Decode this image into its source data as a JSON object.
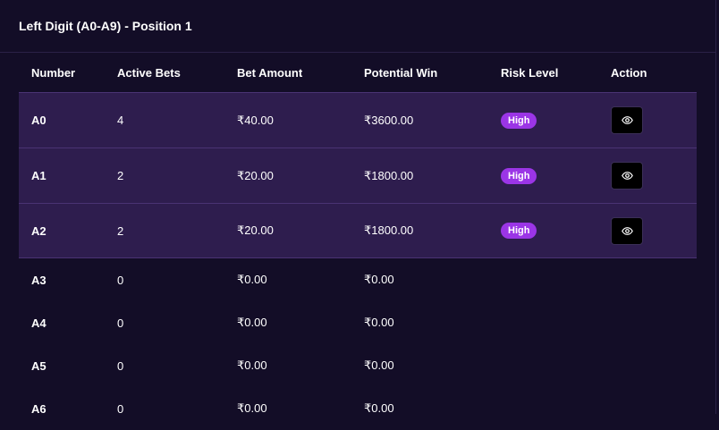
{
  "panel": {
    "title": "Left Digit (A0-A9) - Position 1"
  },
  "table": {
    "headers": {
      "number": "Number",
      "active_bets": "Active Bets",
      "bet_amount": "Bet Amount",
      "potential_win": "Potential Win",
      "risk_level": "Risk Level",
      "action": "Action"
    },
    "rows": [
      {
        "number": "A0",
        "active_bets": "4",
        "bet_amount": "₹40.00",
        "potential_win": "₹3600.00",
        "risk": "High",
        "action_icon": "eye-icon"
      },
      {
        "number": "A1",
        "active_bets": "2",
        "bet_amount": "₹20.00",
        "potential_win": "₹1800.00",
        "risk": "High",
        "action_icon": "eye-icon"
      },
      {
        "number": "A2",
        "active_bets": "2",
        "bet_amount": "₹20.00",
        "potential_win": "₹1800.00",
        "risk": "High",
        "action_icon": "eye-icon"
      },
      {
        "number": "A3",
        "active_bets": "0",
        "bet_amount": "₹0.00",
        "potential_win": "₹0.00"
      },
      {
        "number": "A4",
        "active_bets": "0",
        "bet_amount": "₹0.00",
        "potential_win": "₹0.00"
      },
      {
        "number": "A5",
        "active_bets": "0",
        "bet_amount": "₹0.00",
        "potential_win": "₹0.00"
      },
      {
        "number": "A6",
        "active_bets": "0",
        "bet_amount": "₹0.00",
        "potential_win": "₹0.00"
      }
    ]
  },
  "colors": {
    "background": "#130d27",
    "highlight_row": "#2e1d4e",
    "risk_high_badge": "#9b35e6",
    "action_button": "#000000"
  }
}
